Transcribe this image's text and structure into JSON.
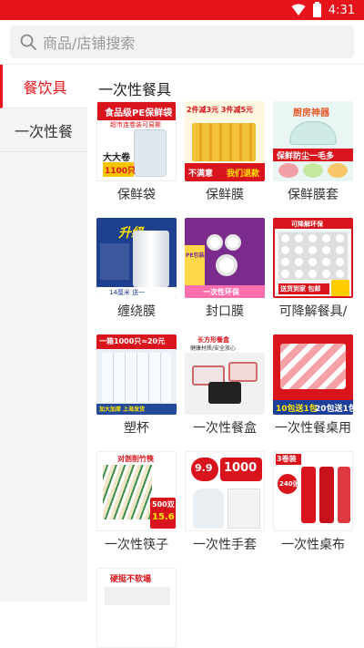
{
  "status_bar": {
    "time": "4:31"
  },
  "search": {
    "placeholder": "商品/店铺搜索"
  },
  "sidebar": {
    "items": [
      {
        "label": "餐饮具",
        "active": true
      },
      {
        "label": "一次性餐",
        "active": false
      }
    ]
  },
  "section": {
    "title": "一次性餐具"
  },
  "products": [
    {
      "label": "保鲜袋",
      "texts": [
        "食品级PE保鲜袋",
        "超市连卷装可易撕",
        "大大卷",
        "1100只"
      ]
    },
    {
      "label": "保鲜膜",
      "texts": [
        "2件减3元 3件减5元",
        "不满意",
        "我们退款"
      ]
    },
    {
      "label": "保鲜膜套",
      "texts": [
        "厨房神器",
        "保鲜防尘一毛多"
      ]
    },
    {
      "label": "缠绕膜",
      "texts": [
        "14厘米 送一",
        "升级"
      ]
    },
    {
      "label": "封口膜",
      "texts": [
        "PE包装膜",
        "一次性环保"
      ]
    },
    {
      "label": "可降解餐具/",
      "texts": [
        "可降解环保",
        "送货到家 包邮"
      ]
    },
    {
      "label": "塑杯",
      "texts": [
        "一箱1000只≈20元",
        "加大加厚 上海发货"
      ]
    },
    {
      "label": "一次性餐盒",
      "texts": [
        "长方形餐盒",
        "健康材质/安全放心"
      ]
    },
    {
      "label": "一次性餐桌用",
      "texts": [
        "10包送1包",
        "20包送1包"
      ]
    },
    {
      "label": "一次性筷子",
      "texts": [
        "对剖削竹筷",
        "500双",
        "15.6"
      ]
    },
    {
      "label": "一次性手套",
      "texts": [
        "9.9",
        "1000"
      ]
    },
    {
      "label": "一次性桌布",
      "texts": [
        "3卷装",
        "240张"
      ]
    },
    {
      "label": "",
      "texts": [
        "硬挺不软塌"
      ]
    }
  ],
  "colors": {
    "brand_red": "#e8141c",
    "sidebar_bg": "#f4f4f4",
    "search_bg": "#f2f2f2"
  }
}
